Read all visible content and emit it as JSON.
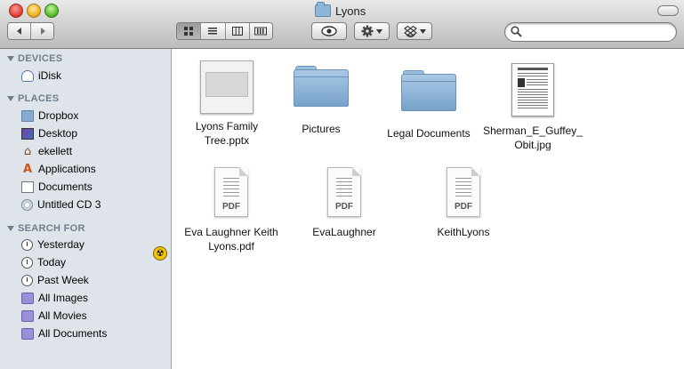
{
  "window": {
    "title": "Lyons"
  },
  "toolbar": {
    "back_icon": "back-arrow-icon",
    "forward_icon": "forward-arrow-icon",
    "views": [
      "icon-view",
      "list-view",
      "column-view",
      "coverflow-view"
    ],
    "active_view": "icon-view",
    "quicklook_icon": "eye-icon",
    "action_icon": "gear-icon",
    "dropbox_icon": "dropbox-icon",
    "search": {
      "value": "",
      "placeholder": ""
    }
  },
  "sidebar": {
    "devices": {
      "heading": "DEVICES",
      "items": [
        {
          "label": "iDisk",
          "icon": "idisk-icon"
        }
      ]
    },
    "places": {
      "heading": "PLACES",
      "items": [
        {
          "label": "Dropbox",
          "icon": "folder-icon"
        },
        {
          "label": "Desktop",
          "icon": "desktop-icon"
        },
        {
          "label": "ekellett",
          "icon": "home-icon"
        },
        {
          "label": "Applications",
          "icon": "applications-icon"
        },
        {
          "label": "Documents",
          "icon": "documents-icon"
        },
        {
          "label": "Untitled CD 3",
          "icon": "cd-icon",
          "eject_icon": "radioactive-burn-icon"
        }
      ]
    },
    "search_for": {
      "heading": "SEARCH FOR",
      "items": [
        {
          "label": "Yesterday",
          "icon": "clock-icon"
        },
        {
          "label": "Today",
          "icon": "clock-icon"
        },
        {
          "label": "Past Week",
          "icon": "clock-icon"
        },
        {
          "label": "All Images",
          "icon": "smart-folder-icon"
        },
        {
          "label": "All Movies",
          "icon": "smart-folder-icon"
        },
        {
          "label": "All Documents",
          "icon": "smart-folder-icon"
        }
      ]
    }
  },
  "files": [
    {
      "name": "Lyons Family\nTree.pptx",
      "icon": "pptx-thumbnail"
    },
    {
      "name": "Pictures",
      "icon": "folder-icon"
    },
    {
      "name": "Legal Documents",
      "icon": "folder-icon"
    },
    {
      "name": "Sherman_E_Guffey_\nObit.jpg",
      "icon": "jpg-thumbnail"
    },
    {
      "name": "Eva Laughner Keith\nLyons.pdf",
      "icon": "pdf-icon",
      "badge": "PDF"
    },
    {
      "name": "EvaLaughner",
      "icon": "pdf-icon",
      "badge": "PDF"
    },
    {
      "name": "KeithLyons",
      "icon": "pdf-icon",
      "badge": "PDF"
    }
  ]
}
